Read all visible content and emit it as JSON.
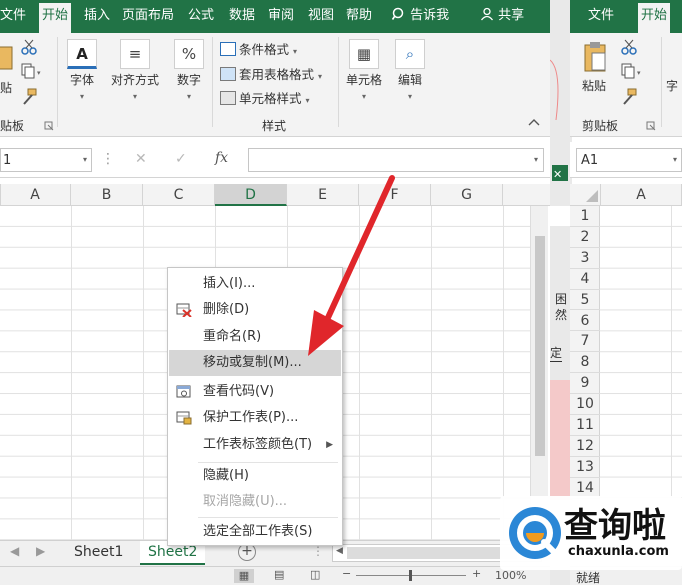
{
  "ribbon_tabs": [
    "文件",
    "开始",
    "插入",
    "页面布局",
    "公式",
    "数据",
    "审阅",
    "视图",
    "帮助"
  ],
  "tell_me": "告诉我",
  "share": "共享",
  "clipboard": {
    "paste_suffix": "贴",
    "group_label_suffix": "贴板"
  },
  "groups": {
    "font": "字体",
    "align": "对齐方式",
    "number": "数字",
    "cond_format": "条件格式",
    "table_format": "套用表格格式",
    "cell_style": "单元格样式",
    "styles_label": "样式",
    "cells": "单元格",
    "edit": "编辑"
  },
  "formula_bar": {
    "name_box": "1",
    "fx": "fx",
    "cancel": "✕",
    "enter": "✓"
  },
  "columns": [
    "A",
    "B",
    "C",
    "D",
    "E",
    "F",
    "G"
  ],
  "selected_column": "D",
  "sheets": [
    "Sheet1",
    "Sheet2"
  ],
  "active_sheet": "Sheet2",
  "status": {
    "zoom": "100%"
  },
  "context_menu": [
    {
      "label": "插入(I)...",
      "icon": ""
    },
    {
      "label": "删除(D)",
      "icon": "delete-sheet-icon"
    },
    {
      "label": "重命名(R)",
      "icon": ""
    },
    {
      "label": "移动或复制(M)...",
      "icon": "",
      "highlighted": true
    },
    {
      "label": "查看代码(V)",
      "icon": "view-code-icon"
    },
    {
      "label": "保护工作表(P)...",
      "icon": "protect-sheet-icon"
    },
    {
      "label": "工作表标签颜色(T)",
      "icon": "",
      "submenu": true
    },
    {
      "label": "隐藏(H)",
      "icon": ""
    },
    {
      "label": "取消隐藏(U)...",
      "icon": "",
      "disabled": true
    },
    {
      "label": "选定全部工作表(S)",
      "icon": ""
    }
  ],
  "right_window": {
    "tabs": [
      "文件",
      "开始"
    ],
    "paste": "粘贴",
    "clipboard_label": "剪贴板",
    "font_partial": "字",
    "name_box": "A1",
    "column": "A",
    "rows": [
      "1",
      "2",
      "3",
      "4",
      "5",
      "6",
      "7",
      "8",
      "9",
      "10",
      "11",
      "12",
      "13",
      "14"
    ],
    "status": "就绪",
    "side_text_1": "困",
    "side_text_2": "然",
    "side_text_3": "定"
  },
  "watermark": {
    "brand": "查询啦",
    "domain": "chaxunla.com"
  },
  "colors": {
    "excel_green": "#217346",
    "arrow_red": "#e0262b"
  }
}
